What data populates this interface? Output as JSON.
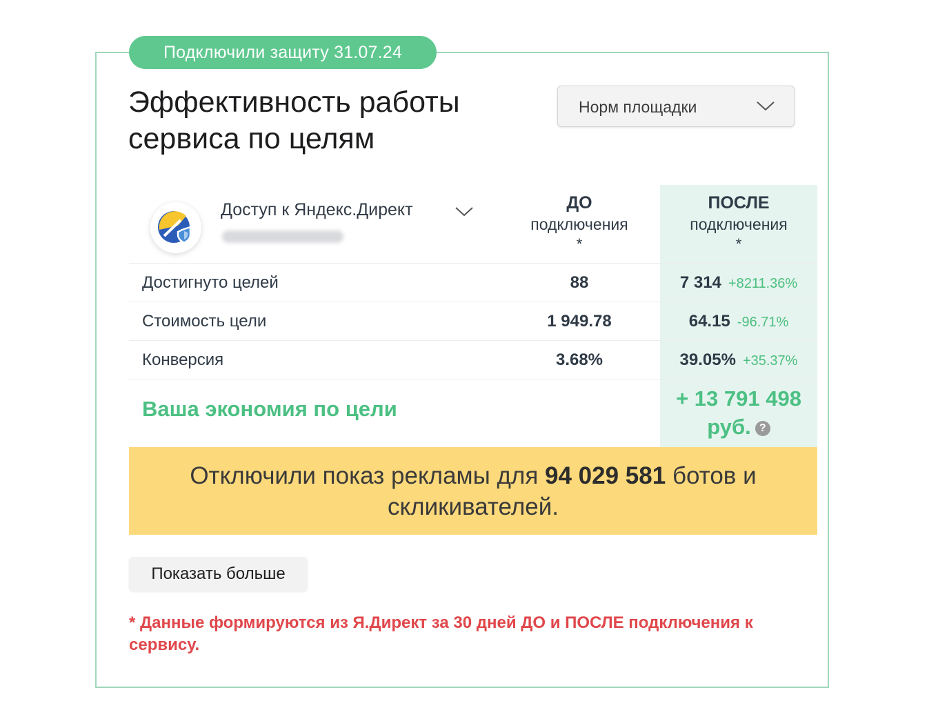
{
  "badge": "Подключили защиту 31.07.24",
  "title": "Эффективность работы сервиса по целям",
  "filter": {
    "selected": "Норм площадки"
  },
  "account": {
    "name": "Доступ к Яндекс.Директ"
  },
  "columns": {
    "before_main": "ДО",
    "before_sub": "подключения",
    "after_main": "ПОСЛЕ",
    "after_sub": "подключения",
    "star": "*"
  },
  "rows": [
    {
      "label": "Достигнуто целей",
      "before": "88",
      "after": "7 314",
      "delta": "+8211.36%"
    },
    {
      "label": "Стоимость цели",
      "before": "1 949.78",
      "after": "64.15",
      "delta": "-96.71%"
    },
    {
      "label": "Конверсия",
      "before": "3.68%",
      "after": "39.05%",
      "delta": "+35.37%"
    }
  ],
  "savings": {
    "label": "Ваша экономия по цели",
    "value": "+ 13 791 498",
    "unit": "руб.",
    "help": "?"
  },
  "banner": {
    "prefix": "Отключили показ рекламы для",
    "count": "94 029 581",
    "suffix": "ботов и скликивателей."
  },
  "more_button": "Показать больше",
  "footnote": "* Данные формируются из Я.Директ за 30 дней ДО и ПОСЛЕ подключения к сервису.",
  "colors": {
    "accent_green": "#5ec88f",
    "savings_green": "#4cc083",
    "banner_yellow": "#fcd97b",
    "footnote_red": "#e0474b",
    "after_bg": "#e5f4ef"
  }
}
